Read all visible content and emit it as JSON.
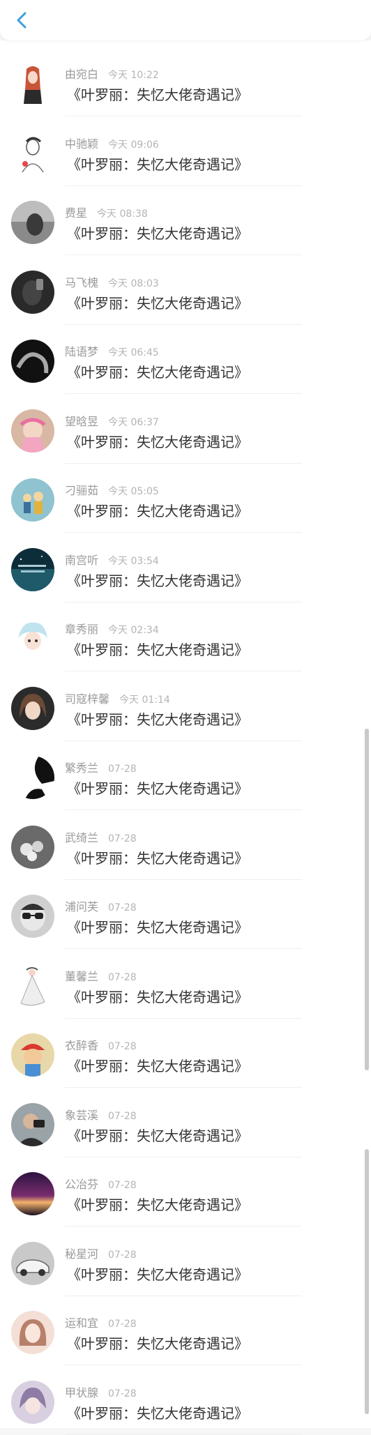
{
  "header": {
    "back_icon": "chevron-left-icon",
    "accent_color": "#3a9fe0"
  },
  "messages": [
    {
      "name": "由宛白",
      "time": "今天 10:22",
      "text": "《叶罗丽：失忆大佬奇遇记》"
    },
    {
      "name": "中驰颖",
      "time": "今天 09:06",
      "text": "《叶罗丽：失忆大佬奇遇记》"
    },
    {
      "name": "费星",
      "time": "今天 08:38",
      "text": "《叶罗丽：失忆大佬奇遇记》"
    },
    {
      "name": "马飞槐",
      "time": "今天 08:03",
      "text": "《叶罗丽：失忆大佬奇遇记》"
    },
    {
      "name": "陆语梦",
      "time": "今天 06:45",
      "text": "《叶罗丽：失忆大佬奇遇记》"
    },
    {
      "name": "望晗昱",
      "time": "今天 06:37",
      "text": "《叶罗丽：失忆大佬奇遇记》"
    },
    {
      "name": "刁骊茹",
      "time": "今天 05:05",
      "text": "《叶罗丽：失忆大佬奇遇记》"
    },
    {
      "name": "南宫听",
      "time": "今天 03:54",
      "text": "《叶罗丽：失忆大佬奇遇记》"
    },
    {
      "name": "章秀丽",
      "time": "今天 02:34",
      "text": "《叶罗丽：失忆大佬奇遇记》"
    },
    {
      "name": "司寇梓馨",
      "time": "今天 01:14",
      "text": "《叶罗丽：失忆大佬奇遇记》"
    },
    {
      "name": "繁秀兰",
      "time": "07-28",
      "text": "《叶罗丽：失忆大佬奇遇记》"
    },
    {
      "name": "武绮兰",
      "time": "07-28",
      "text": "《叶罗丽：失忆大佬奇遇记》"
    },
    {
      "name": "浦问芙",
      "time": "07-28",
      "text": "《叶罗丽：失忆大佬奇遇记》"
    },
    {
      "name": "董馨兰",
      "time": "07-28",
      "text": "《叶罗丽：失忆大佬奇遇记》"
    },
    {
      "name": "衣醉香",
      "time": "07-28",
      "text": "《叶罗丽：失忆大佬奇遇记》"
    },
    {
      "name": "象芸溪",
      "time": "07-28",
      "text": "《叶罗丽：失忆大佬奇遇记》"
    },
    {
      "name": "公冶芬",
      "time": "07-28",
      "text": "《叶罗丽：失忆大佬奇遇记》"
    },
    {
      "name": "秘星河",
      "time": "07-28",
      "text": "《叶罗丽：失忆大佬奇遇记》"
    },
    {
      "name": "运和宜",
      "time": "07-28",
      "text": "《叶罗丽：失忆大佬奇遇记》"
    },
    {
      "name": "甲状腺",
      "time": "07-28",
      "text": "《叶罗丽：失忆大佬奇遇记》"
    }
  ]
}
